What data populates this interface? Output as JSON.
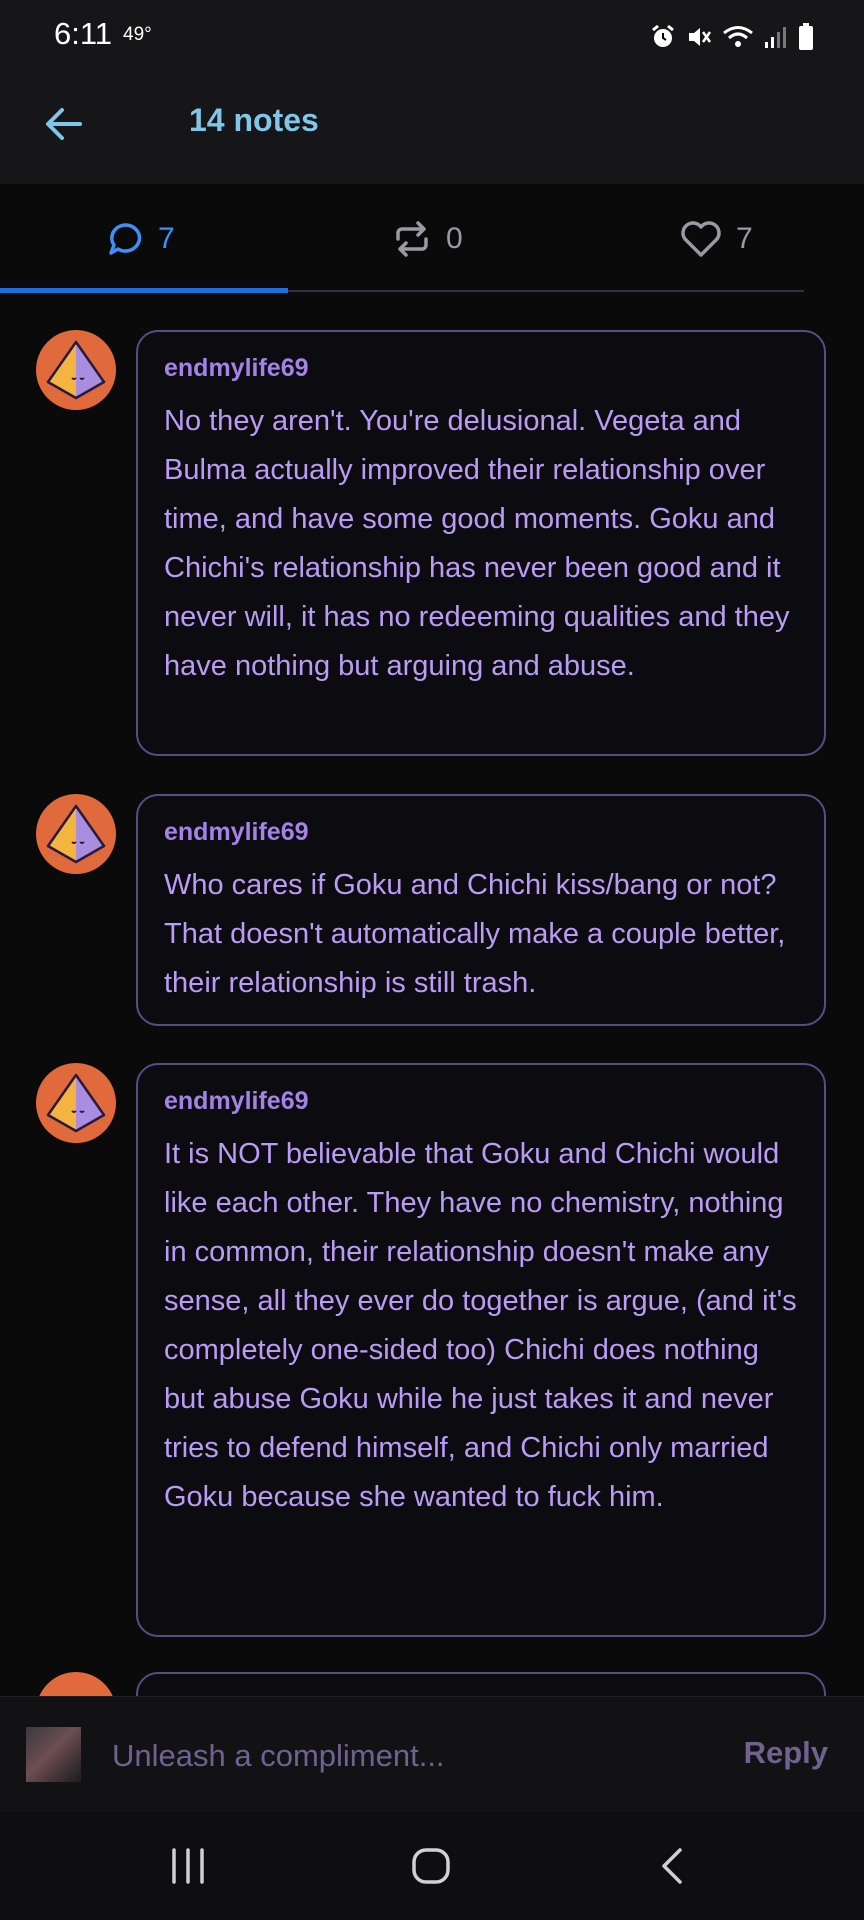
{
  "status_bar": {
    "time": "6:11",
    "temperature": "49°"
  },
  "header": {
    "title": "14 notes",
    "back_icon": "arrow-left-icon"
  },
  "tabs": [
    {
      "name": "replies",
      "icon": "speech-bubble-icon",
      "count": "7",
      "active": true
    },
    {
      "name": "reblogs",
      "icon": "reblog-icon",
      "count": "0",
      "active": false
    },
    {
      "name": "likes",
      "icon": "heart-icon",
      "count": "7",
      "active": false
    }
  ],
  "notes": [
    {
      "author": "endmylife69",
      "text": "No they aren't. You're delusional. Vegeta and Bulma actually improved their relationship over time, and have some good moments. Goku and Chichi's relationship has never been good and it never will, it has no redeeming qualities and they have nothing but arguing and abuse."
    },
    {
      "author": "endmylife69",
      "text": "Who cares if Goku and Chichi kiss/bang or not? That doesn't automatically make a couple better, their relationship is still trash."
    },
    {
      "author": "endmylife69",
      "text": "It is NOT believable that Goku and Chichi would like each other. They have no chemistry, nothing in common, their relationship doesn't make any sense, all they ever do together is argue, (and it's completely one-sided too) Chichi does nothing but abuse Goku while he just takes it and never tries to defend himself, and Chichi only married Goku because she wanted to fuck him."
    }
  ],
  "reply_bar": {
    "placeholder": "Unleash a compliment...",
    "reply_label": "Reply"
  },
  "colors": {
    "accent_blue": "#3f8ff7",
    "header_title": "#7fc6e8",
    "note_text": "#b99cf5",
    "bubble_border": "#5c4a82",
    "avatar_bg": "#e06a3c"
  }
}
